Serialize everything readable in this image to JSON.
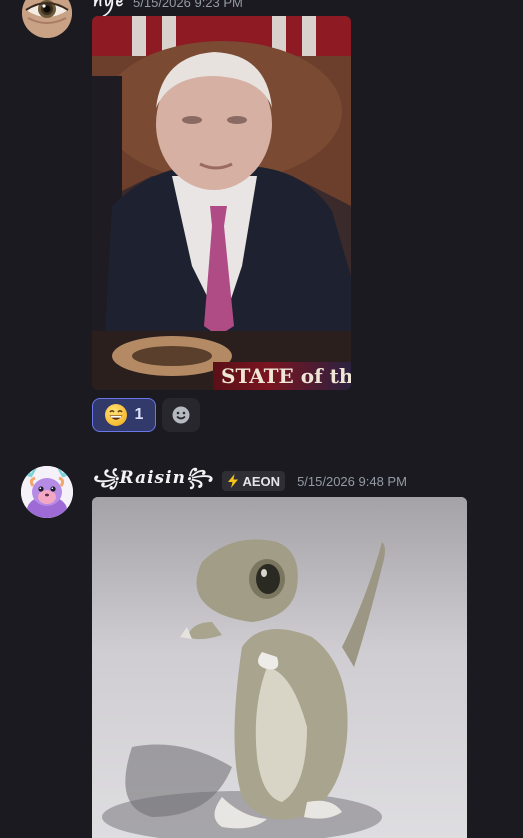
{
  "messages": [
    {
      "username": "ꪀꪗꫀ",
      "timestamp": "5/15/2026 9:23 PM",
      "avatar": "eye-closeup-avatar",
      "attachment": {
        "type": "gif",
        "caption": "STATE of th"
      },
      "reactions": [
        {
          "emoji": "grinning-face-emoji",
          "count": "1",
          "active": true
        },
        {
          "icon": "add-reaction-icon"
        }
      ]
    },
    {
      "username": "꧁Raisin꧂",
      "tag": {
        "icon": "bolt-icon",
        "label": "AEON"
      },
      "timestamp": "5/15/2026 9:48 PM",
      "avatar": "furry-creature-avatar",
      "attachment": {
        "type": "gif",
        "subject": "dancing-lizard"
      }
    }
  ],
  "colors": {
    "background": "#1b1a20",
    "reaction_active_bg": "#323a6b",
    "reaction_active_border": "#6a77e8",
    "timestamp": "#949ba4",
    "username": "#f2f3f5"
  }
}
